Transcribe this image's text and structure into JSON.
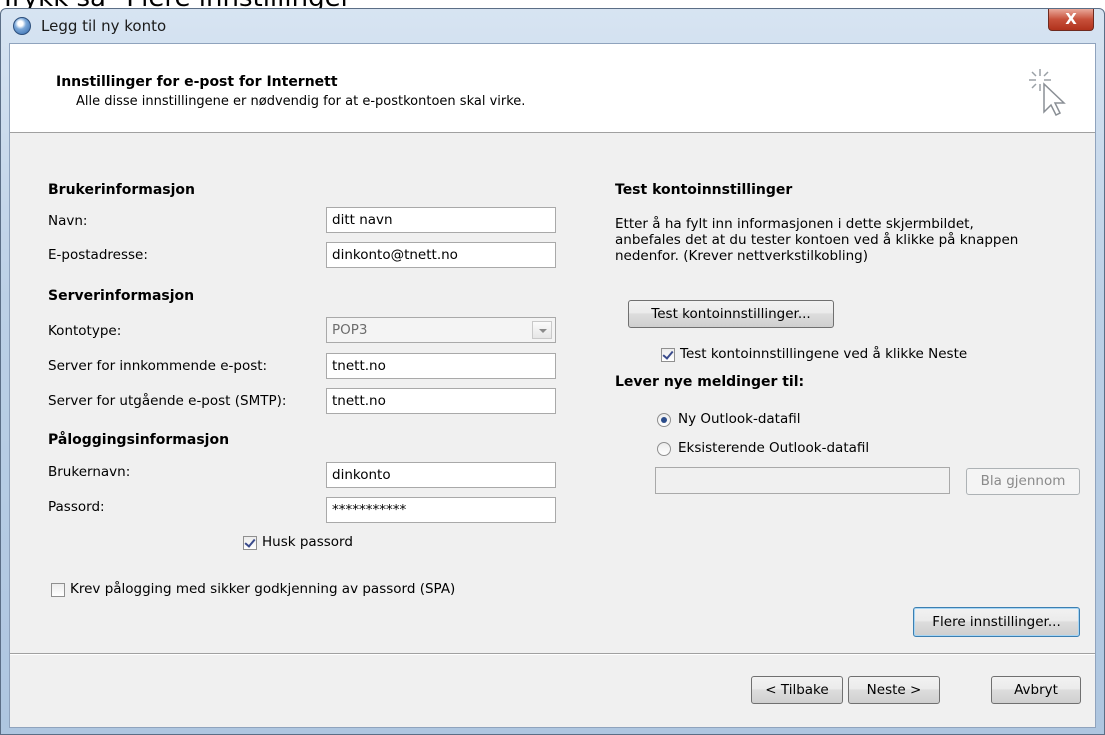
{
  "top_text": "Trykk så \"Flere innstillinger\"",
  "window": {
    "title": "Legg til ny konto",
    "close_label": "X"
  },
  "header": {
    "title": "Innstillinger for e-post for Internett",
    "subtitle": "Alle disse innstillingene er nødvendig for at e-postkontoen skal virke."
  },
  "user_info": {
    "heading": "Brukerinformasjon",
    "name_label": "Navn:",
    "name_value": "ditt navn",
    "email_label": "E-postadresse:",
    "email_value": "dinkonto@tnett.no"
  },
  "server_info": {
    "heading": "Serverinformasjon",
    "account_type_label": "Kontotype:",
    "account_type_value": "POP3",
    "incoming_label": "Server for innkommende e-post:",
    "incoming_value": "tnett.no",
    "outgoing_label": "Server for utgående e-post (SMTP):",
    "outgoing_value": "tnett.no"
  },
  "login_info": {
    "heading": "Påloggingsinformasjon",
    "username_label": "Brukernavn:",
    "username_value": "dinkonto",
    "password_label": "Passord:",
    "password_value": "***********",
    "remember_label": "Husk passord",
    "remember_checked": true,
    "spa_label": "Krev pålogging med sikker godkjenning av passord (SPA)",
    "spa_checked": false
  },
  "test": {
    "heading": "Test kontoinnstillinger",
    "description_1": "Etter å ha fylt inn informasjonen i dette skjermbildet,",
    "description_2": "anbefales det at du tester kontoen ved å klikke på knappen",
    "description_3": "nedenfor. (Krever nettverkstilkobling)",
    "button_label": "Test kontoinnstillinger...",
    "auto_label": "Test kontoinnstillingene ved å klikke Neste",
    "auto_checked": true
  },
  "deliver": {
    "heading": "Lever nye meldinger til:",
    "new_file_label": "Ny Outlook-datafil",
    "new_file_selected": true,
    "existing_file_label": "Eksisterende Outlook-datafil",
    "path_value": "",
    "browse_label": "Bla gjennom"
  },
  "more_settings_label": "Flere innstillinger...",
  "footer": {
    "back_label": "< Tilbake",
    "next_label": "Neste >",
    "cancel_label": "Avbryt"
  },
  "colors": {
    "title_gradient_top": "#d7e4f2",
    "close_button": "#c7503a",
    "dialog_bg": "#f0f0f0",
    "default_button_border": "#3c7fb1"
  }
}
